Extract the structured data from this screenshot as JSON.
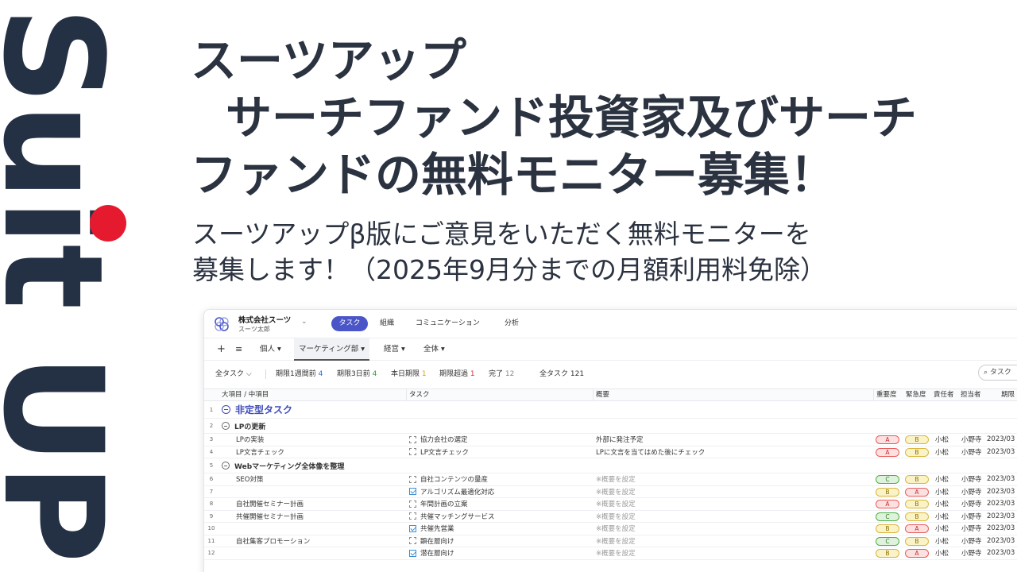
{
  "logo": {
    "text": "Suit UP"
  },
  "headline": {
    "line1": "スーツアップ",
    "line2": "サーチファンド投資家及びサーチ",
    "line3": "ファンドの無料モニター募集！"
  },
  "subline": {
    "line1": "スーツアップβ版にご意見をいただく無料モニターを",
    "line2": "募集します！（2025年9月分までの月額利用料免除）"
  },
  "app": {
    "company": "株式会社スーツ",
    "user": "スーツ太郎",
    "nav": [
      "タスク",
      "組織",
      "コミュニケーション",
      "分析"
    ],
    "views": {
      "plus": "+",
      "menu": "≡",
      "person": "個人 ▾",
      "marketing": "マーケティング部 ▾",
      "management": "経営 ▾",
      "all": "全体 ▾"
    },
    "filters": {
      "all_tasks": "全タスク ⌵",
      "week_before_label": "期限1週間前",
      "week_before_count": "4",
      "three_days_label": "期限3日前",
      "three_days_count": "4",
      "today_label": "本日期限",
      "today_count": "1",
      "overdue_label": "期限超過",
      "overdue_count": "1",
      "done_label": "完了",
      "done_count": "12",
      "total_label": "全タスク",
      "total_count": "121",
      "search_placeholder": "タスク"
    },
    "columns": {
      "category": "大項目 / 中項目",
      "task": "タスク",
      "summary": "概要",
      "importance": "重要度",
      "urgency": "緊急度",
      "responsible": "責任者",
      "assignee": "担当者",
      "deadline": "期限"
    },
    "rows": [
      {
        "n": "1",
        "type": "g1",
        "title": "非定型タスク"
      },
      {
        "n": "2",
        "type": "g2",
        "title": "LPの更新"
      },
      {
        "n": "3",
        "cat": "LPの実装",
        "task": "協力会社の選定",
        "done": false,
        "sum": "外部に発注予定",
        "ph": false,
        "imp": "A",
        "urg": "B",
        "resp": "小松",
        "assg": "小野寺",
        "date": "2023/03"
      },
      {
        "n": "4",
        "cat": "LP文言チェック",
        "task": "LP文言チェック",
        "done": false,
        "sum": "LPに文言を当てはめた後にチェック",
        "ph": false,
        "imp": "A",
        "urg": "B",
        "resp": "小松",
        "assg": "小野寺",
        "date": "2023/03"
      },
      {
        "n": "5",
        "type": "g2",
        "title": "Webマーケティング全体像を整理"
      },
      {
        "n": "6",
        "cat": "SEO対策",
        "task": "自社コンテンツの量産",
        "done": false,
        "sum": "※概要を設定",
        "ph": true,
        "imp": "C",
        "urg": "B",
        "resp": "小松",
        "assg": "小野寺",
        "date": "2023/03"
      },
      {
        "n": "7",
        "cat": "",
        "task": "アルゴリズム最適化対応",
        "done": true,
        "sum": "※概要を設定",
        "ph": true,
        "imp": "B",
        "urg": "A",
        "resp": "小松",
        "assg": "小野寺",
        "date": "2023/03"
      },
      {
        "n": "8",
        "cat": "自社開催セミナー計画",
        "task": "年間計画の立案",
        "done": false,
        "sum": "※概要を設定",
        "ph": true,
        "imp": "A",
        "urg": "B",
        "resp": "小松",
        "assg": "小野寺",
        "date": "2023/03"
      },
      {
        "n": "9",
        "cat": "共催開催セミナー計画",
        "task": "共催マッチングサービス",
        "done": false,
        "sum": "※概要を設定",
        "ph": true,
        "imp": "C",
        "urg": "B",
        "resp": "小松",
        "assg": "小野寺",
        "date": "2023/03"
      },
      {
        "n": "10",
        "cat": "",
        "task": "共催先営業",
        "done": true,
        "sum": "※概要を設定",
        "ph": true,
        "imp": "B",
        "urg": "A",
        "resp": "小松",
        "assg": "小野寺",
        "date": "2023/03"
      },
      {
        "n": "11",
        "cat": "自社集客プロモーション",
        "task": "顕在層向け",
        "done": false,
        "sum": "※概要を設定",
        "ph": true,
        "imp": "C",
        "urg": "B",
        "resp": "小松",
        "assg": "小野寺",
        "date": "2023/03"
      },
      {
        "n": "12",
        "cat": "",
        "task": "潜在層向け",
        "done": true,
        "sum": "※概要を設定",
        "ph": true,
        "imp": "B",
        "urg": "A",
        "resp": "小松",
        "assg": "小野寺",
        "date": "2023/03"
      }
    ]
  }
}
